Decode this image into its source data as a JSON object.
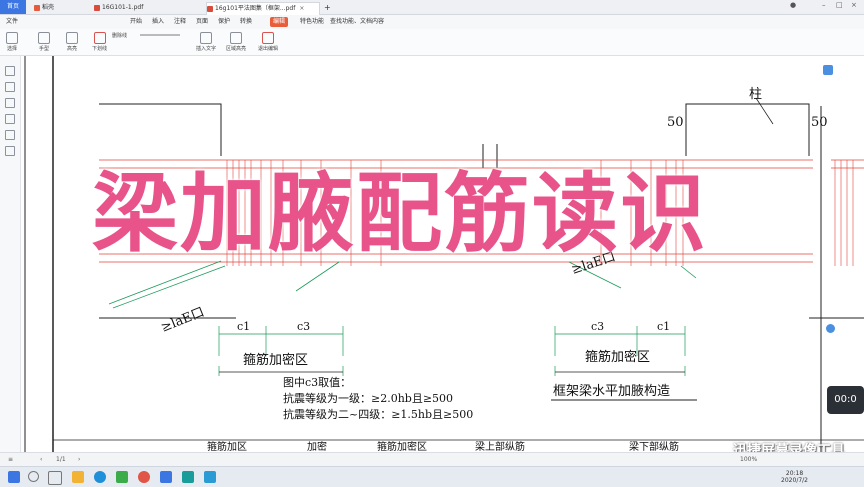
{
  "tabs": {
    "home": "首页",
    "items": [
      {
        "label": "稻壳",
        "color": "#e65a3a"
      },
      {
        "label": "16G101-1.pdf",
        "color": "#d94b3a"
      },
      {
        "label": "16g101平法图集（框架...pdf",
        "color": "#d94b3a"
      }
    ],
    "new_tab": "+"
  },
  "menus": [
    "文件",
    "开始",
    "插入",
    "注释",
    "页面",
    "保护",
    "转换",
    "编辑",
    "特色功能",
    "查找功能、文档内容"
  ],
  "selected_menu": "编辑",
  "ribbon": [
    "选择",
    "手型",
    "高亮",
    "下划线",
    "删除线",
    "插入文字",
    "区域高亮",
    "文字批注",
    "批注模式",
    "退出编辑"
  ],
  "drawing": {
    "label_50_left": "50",
    "label_50_right": "50",
    "label_col": "柱",
    "label_lae_left": "≥laE口",
    "label_lae_right": "≥laE口",
    "dim_c1_left": "c1",
    "dim_c3_left": "c3",
    "dim_c3_right": "c3",
    "dim_c1_right": "c1",
    "zone_left": "箍筋加密区",
    "zone_right": "箍筋加密区",
    "figure_title": "框架梁水平加腋构造",
    "note_title": "图中c3取值：",
    "note_line1": "抗震等级为一级：≥2.0hb且≥500",
    "note_line2": "抗震等级为二~四级：≥1.5hb且≥500",
    "bottom_labels": [
      "箍筋加区",
      "加密",
      "箍筋加密区",
      "梁上部纵筋",
      "梁下部纵筋"
    ]
  },
  "overlay_title": "梁加腋配筋读识",
  "time_badge": "00:0",
  "watermark": "迅捷屏幕录像工具",
  "statusbar": {
    "page": "1/1",
    "zoom": "100%"
  },
  "clock": {
    "time": "20:18",
    "date": "2020/7/2"
  }
}
